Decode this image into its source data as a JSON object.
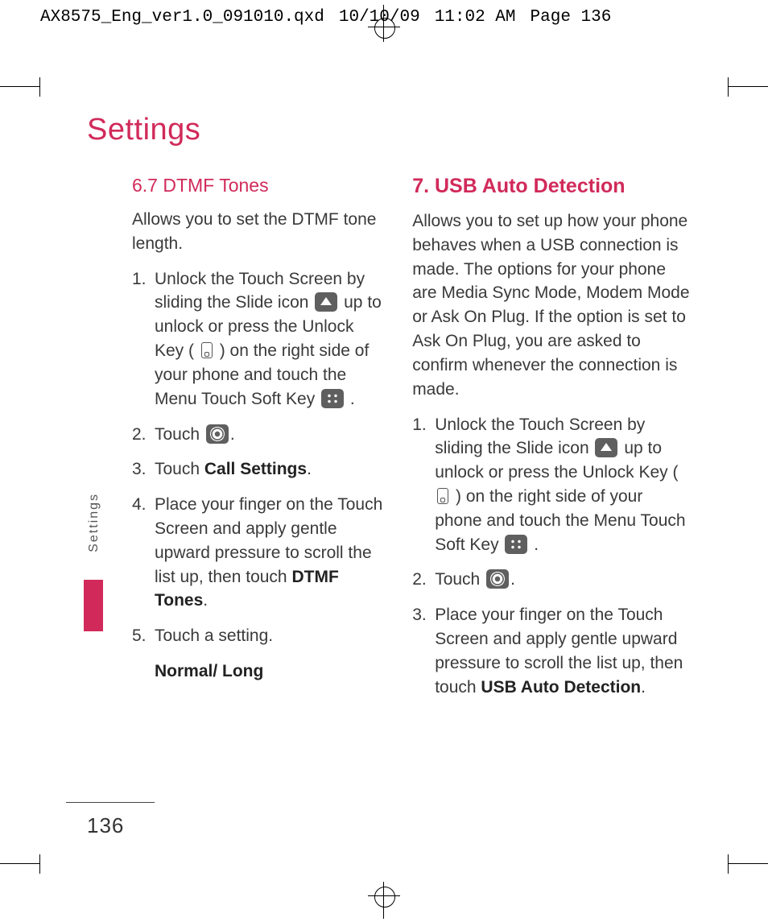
{
  "slug": {
    "file": "AX8575_Eng_ver1.0_091010.qxd",
    "date": "10/10/09",
    "time": "11:02 AM",
    "page": "Page 136"
  },
  "chapter": "Settings",
  "sidetab": "Settings",
  "pagenum": "136",
  "left": {
    "heading": "6.7 DTMF Tones",
    "intro": "Allows you to set the DTMF tone length.",
    "step1a": "Unlock the Touch Screen by sliding the Slide icon ",
    "step1b": " up to unlock or press the Unlock Key ( ",
    "step1c": " ) on the right side of your phone and touch the Menu Touch Soft Key ",
    "step1d": " .",
    "step2a": "Touch  ",
    "step2b": ".",
    "step3a": "Touch ",
    "step3bold": "Call Settings",
    "step3b": ".",
    "step4a": "Place your finger on the Touch Screen and apply gentle upward pressure to scroll the list up, then touch ",
    "step4bold": "DTMF Tones",
    "step4b": ".",
    "step5": "Touch a setting.",
    "step5sub": "Normal/ Long"
  },
  "right": {
    "heading": "7. USB Auto Detection",
    "intro": "Allows you to set up how your phone behaves when a USB connection is made. The options for your phone are Media Sync Mode, Modem Mode or Ask On Plug. If the option is set to Ask On Plug, you are asked to confirm whenever the connection is made.",
    "step1a": "Unlock the Touch Screen by sliding the Slide icon ",
    "step1b": " up to unlock or press the Unlock Key ( ",
    "step1c": " ) on the right side of your phone and touch the Menu Touch Soft Key ",
    "step1d": " .",
    "step2a": "Touch  ",
    "step2b": ".",
    "step3a": "Place your finger on the Touch Screen and apply gentle upward pressure to scroll the list up, then touch ",
    "step3bold": "USB Auto Detection",
    "step3b": "."
  }
}
